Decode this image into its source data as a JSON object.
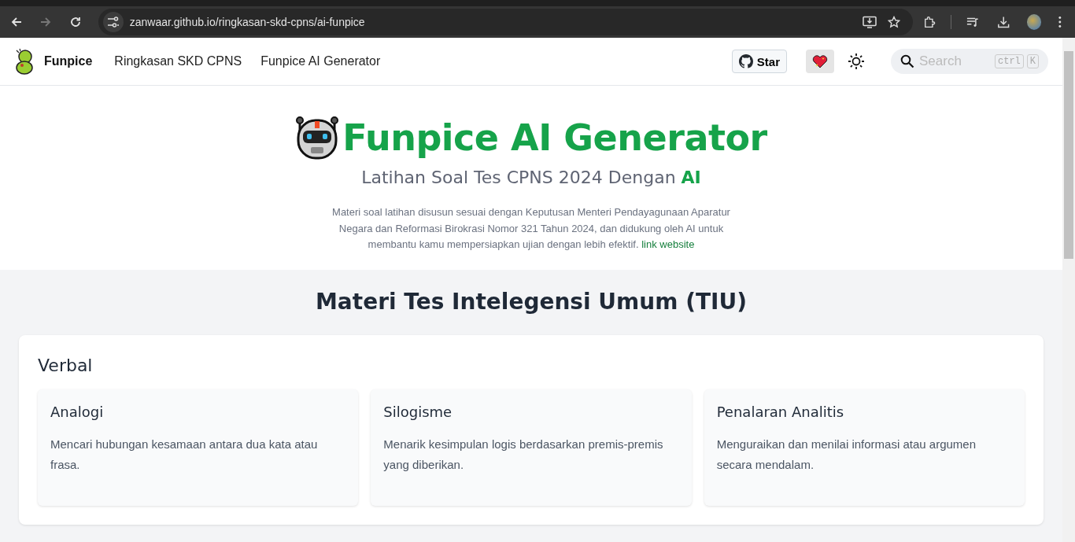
{
  "browser": {
    "nav": [
      {
        "kind": "back",
        "disabled": false
      },
      {
        "kind": "forward",
        "disabled": true
      },
      {
        "kind": "reload",
        "disabled": false
      }
    ],
    "url": "zanwaar.github.io/ringkasan-skd-cpns/ai-funpice"
  },
  "navbar": {
    "brand": "Funpice",
    "links": [
      "Ringkasan SKD CPNS",
      "Funpice AI Generator"
    ],
    "star_button": "Star",
    "search": {
      "placeholder": "Search",
      "keys": [
        "ctrl",
        "K"
      ]
    }
  },
  "hero": {
    "title": "Funpice AI Generator",
    "subtitle": "Latihan Soal Tes CPNS 2024 Dengan",
    "subtitle_highlight": "AI",
    "description": "Materi soal latihan disusun sesuai dengan Keputusan Menteri Pendayagunaan Aparatur Negara dan Reformasi Birokrasi Nomor 321 Tahun 2024, dan didukung oleh AI untuk membantu kamu mempersiapkan ujian dengan lebih efektif.",
    "link": "link website"
  },
  "section": {
    "title": "Materi Tes Intelegensi Umum (TIU)",
    "group": "Verbal",
    "topics": [
      {
        "title": "Analogi",
        "text": "Mencari hubungan kesamaan antara dua kata atau frasa."
      },
      {
        "title": "Silogisme",
        "text": "Menarik kesimpulan logis berdasarkan premis-premis yang diberikan."
      },
      {
        "title": "Penalaran Analitis",
        "text": "Menguraikan dan menilai informasi atau argumen secara mendalam."
      }
    ]
  }
}
